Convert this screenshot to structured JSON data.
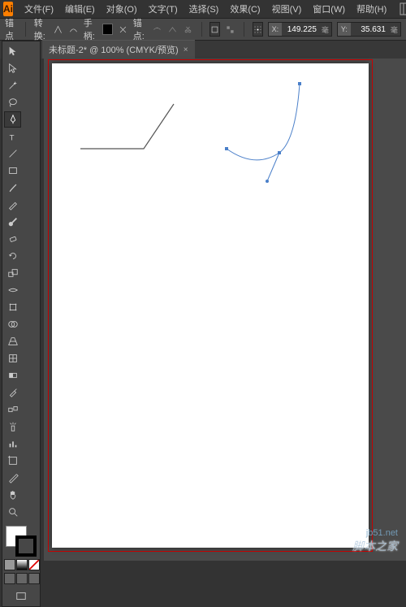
{
  "app_logo": "Ai",
  "menu": [
    "文件(F)",
    "编辑(E)",
    "对象(O)",
    "文字(T)",
    "选择(S)",
    "效果(C)",
    "视图(V)",
    "窗口(W)",
    "帮助(H)"
  ],
  "control": {
    "anchor_label": "锚点",
    "convert_label": "转换:",
    "handle_label": "手柄:",
    "anchor2_label": "锚点:",
    "x_label": "X:",
    "y_label": "Y:",
    "x_value": "149.225",
    "y_value": "35.631",
    "unit": "毫"
  },
  "document": {
    "tab_title": "未标题-2* @ 100% (CMYK/预览)",
    "close": "×"
  },
  "tools": [
    "selection",
    "direct-selection",
    "magic-wand",
    "lasso",
    "pen",
    "type",
    "line",
    "rectangle",
    "paintbrush",
    "pencil",
    "blob-brush",
    "eraser",
    "rotate",
    "scale",
    "width",
    "free-transform",
    "shape-builder",
    "perspective",
    "mesh",
    "gradient",
    "eyedropper",
    "blend",
    "symbol-sprayer",
    "column-graph",
    "artboard",
    "slice",
    "hand",
    "zoom"
  ],
  "mode_colors": [
    "#999",
    "#d33",
    "#fff"
  ],
  "draw_modes": [
    "#666",
    "#666",
    "#666"
  ],
  "watermark_main": "脚本之家",
  "watermark_url": "jb51.net"
}
